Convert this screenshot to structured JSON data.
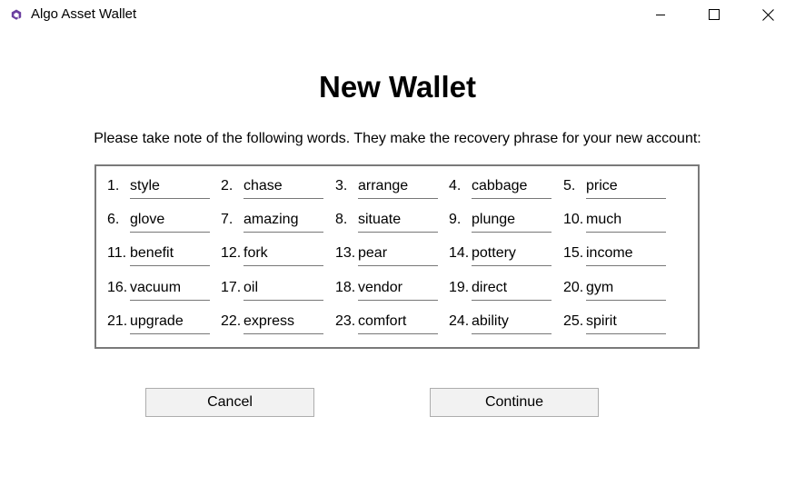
{
  "window": {
    "title": "Algo Asset Wallet",
    "icon": "algo-logo-icon",
    "accent_color": "#6b3fa0",
    "controls": [
      "minimize-icon",
      "maximize-icon",
      "close-icon"
    ]
  },
  "main": {
    "title": "New Wallet",
    "instructions": "Please take note of the following words. They make the recovery phrase for your new account:",
    "words": [
      {
        "num": "1.",
        "word": "style"
      },
      {
        "num": "2.",
        "word": "chase"
      },
      {
        "num": "3.",
        "word": "arrange"
      },
      {
        "num": "4.",
        "word": "cabbage"
      },
      {
        "num": "5.",
        "word": "price"
      },
      {
        "num": "6.",
        "word": "glove"
      },
      {
        "num": "7.",
        "word": "amazing"
      },
      {
        "num": "8.",
        "word": "situate"
      },
      {
        "num": "9.",
        "word": "plunge"
      },
      {
        "num": "10.",
        "word": "much"
      },
      {
        "num": "11.",
        "word": "benefit"
      },
      {
        "num": "12.",
        "word": "fork"
      },
      {
        "num": "13.",
        "word": "pear"
      },
      {
        "num": "14.",
        "word": "pottery"
      },
      {
        "num": "15.",
        "word": "income"
      },
      {
        "num": "16.",
        "word": "vacuum"
      },
      {
        "num": "17.",
        "word": "oil"
      },
      {
        "num": "18.",
        "word": "vendor"
      },
      {
        "num": "19.",
        "word": "direct"
      },
      {
        "num": "20.",
        "word": "gym"
      },
      {
        "num": "21.",
        "word": "upgrade"
      },
      {
        "num": "22.",
        "word": "express"
      },
      {
        "num": "23.",
        "word": "comfort"
      },
      {
        "num": "24.",
        "word": "ability"
      },
      {
        "num": "25.",
        "word": "spirit"
      }
    ]
  },
  "buttons": {
    "cancel_label": "Cancel",
    "continue_label": "Continue"
  }
}
